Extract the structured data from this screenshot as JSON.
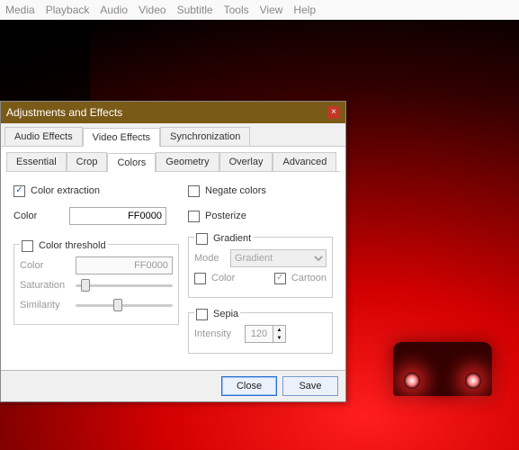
{
  "menu": [
    "Media",
    "Playback",
    "Audio",
    "Video",
    "Subtitle",
    "Tools",
    "View",
    "Help"
  ],
  "dialog": {
    "title": "Adjustments and Effects",
    "close": "×",
    "tabs1": {
      "items": [
        "Audio Effects",
        "Video Effects",
        "Synchronization"
      ],
      "active": 1
    },
    "tabs2": {
      "items": [
        "Essential",
        "Crop",
        "Colors",
        "Geometry",
        "Overlay",
        "Advanced"
      ],
      "active": 2
    },
    "colorExtraction": {
      "label": "Color extraction",
      "checked": true,
      "colorLabel": "Color",
      "colorValue": "FF0000"
    },
    "colorThreshold": {
      "label": "Color threshold",
      "checked": false,
      "colorLabel": "Color",
      "colorValue": "FF0000",
      "saturationLabel": "Saturation",
      "similarityLabel": "Similarity"
    },
    "negate": {
      "label": "Negate colors",
      "checked": false
    },
    "posterize": {
      "label": "Posterize",
      "checked": false
    },
    "gradient": {
      "label": "Gradient",
      "checked": false,
      "modeLabel": "Mode",
      "modeValue": "Gradient",
      "colorLabel": "Color",
      "cartoonLabel": "Cartoon"
    },
    "sepia": {
      "label": "Sepia",
      "checked": false,
      "intensityLabel": "Intensity",
      "intensityValue": "120"
    },
    "buttons": {
      "close": "Close",
      "save": "Save"
    }
  }
}
